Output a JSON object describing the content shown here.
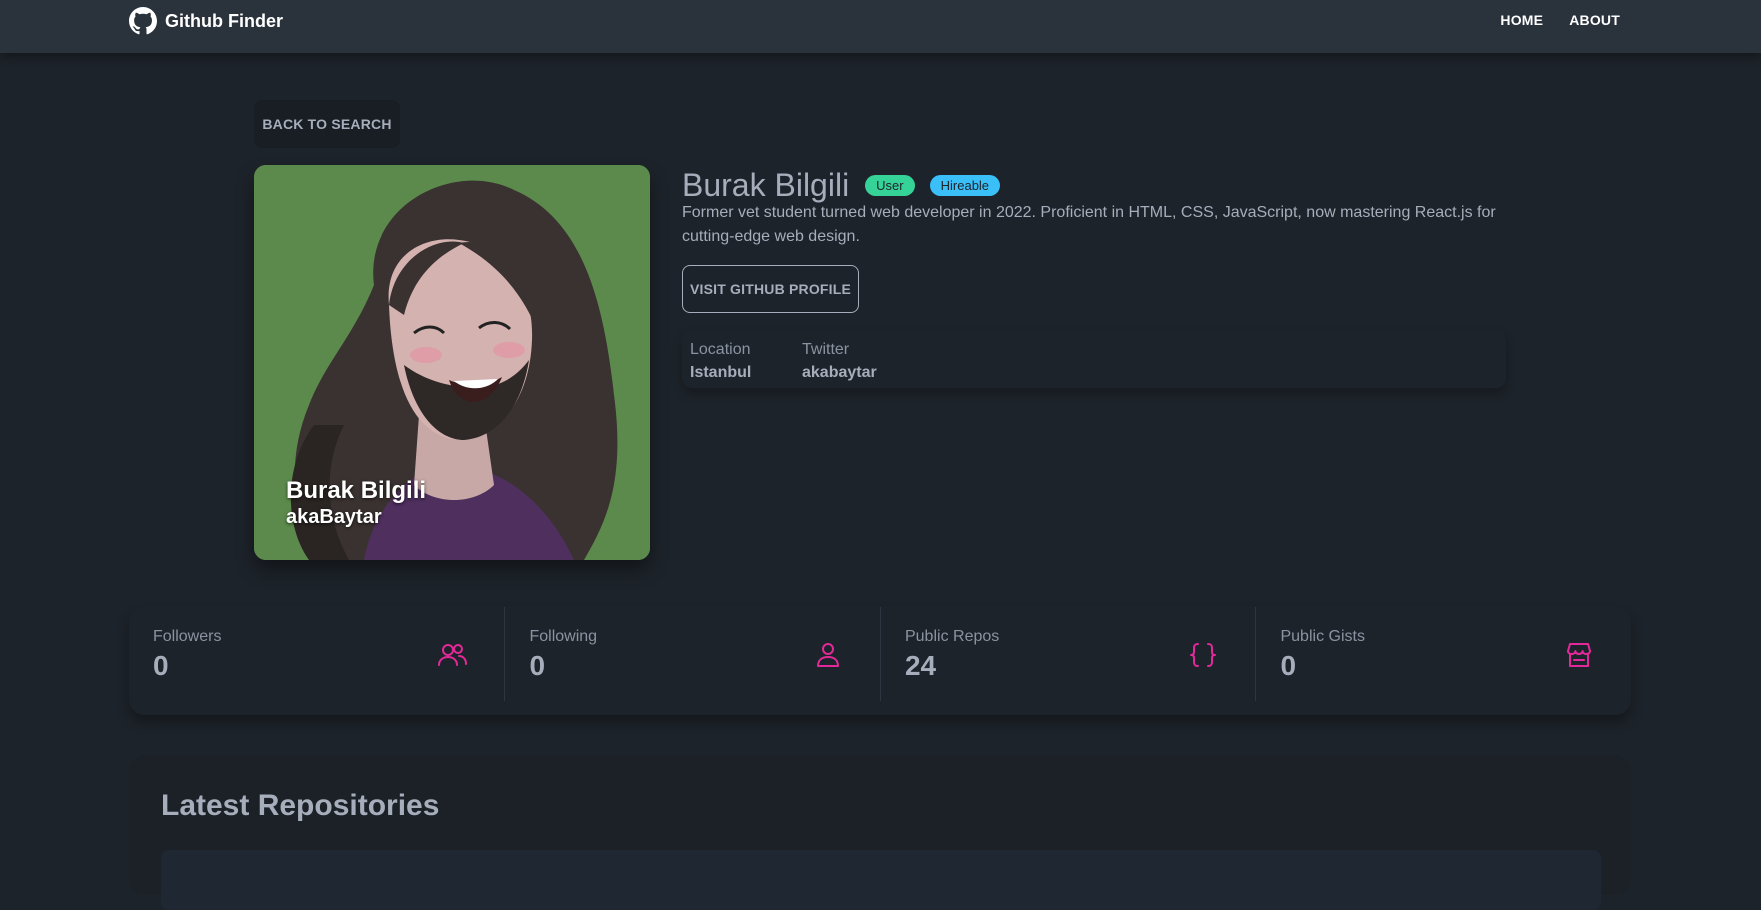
{
  "navbar": {
    "brand": "Github Finder",
    "links": [
      "HOME",
      "ABOUT"
    ]
  },
  "back_button": "BACK TO SEARCH",
  "avatar": {
    "name": "Burak Bilgili",
    "login": "akaBaytar"
  },
  "profile": {
    "name": "Burak Bilgili",
    "badges": [
      "User",
      "Hireable"
    ],
    "bio": "Former vet student turned web developer in 2022. Proficient in HTML, CSS, JavaScript, now mastering React.js for cutting-edge web design.",
    "visit_button": "VISIT GITHUB PROFILE",
    "info": [
      {
        "label": "Location",
        "value": "Istanbul"
      },
      {
        "label": "Twitter",
        "value": "akabaytar"
      }
    ]
  },
  "stats": [
    {
      "title": "Followers",
      "value": "0",
      "icon": "users-icon"
    },
    {
      "title": "Following",
      "value": "0",
      "icon": "user-icon"
    },
    {
      "title": "Public Repos",
      "value": "24",
      "icon": "code-braces-icon"
    },
    {
      "title": "Public Gists",
      "value": "0",
      "icon": "store-icon"
    }
  ],
  "repos": {
    "title": "Latest Repositories"
  },
  "colors": {
    "background": "#1d232a",
    "navbar": "#2a323c",
    "accent_icon": "#e3299a",
    "badge_user": "#36d399",
    "badge_hireable": "#3abff8"
  }
}
